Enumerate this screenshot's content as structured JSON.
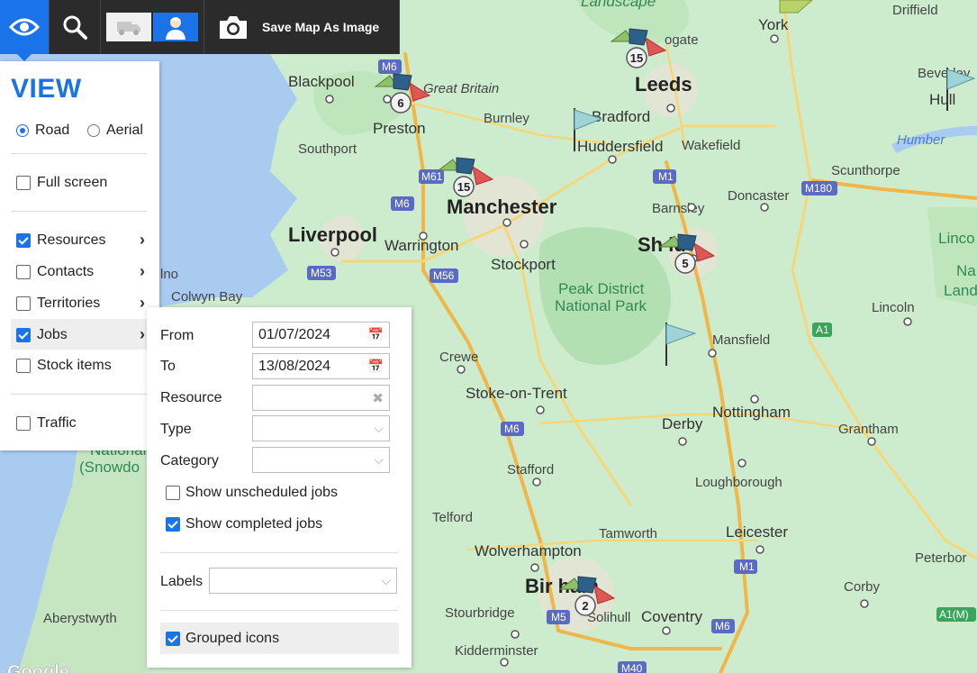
{
  "toolbar": {
    "save_label": "Save Map As Image",
    "accent": "#1a73e8"
  },
  "view_panel": {
    "title": "VIEW",
    "map_types": [
      {
        "label": "Road",
        "selected": true
      },
      {
        "label": "Aerial",
        "selected": false
      }
    ],
    "full_screen": {
      "label": "Full screen",
      "checked": false
    },
    "layers": [
      {
        "label": "Resources",
        "checked": true
      },
      {
        "label": "Contacts",
        "checked": false
      },
      {
        "label": "Territories",
        "checked": false
      },
      {
        "label": "Jobs",
        "checked": true
      },
      {
        "label": "Stock items",
        "checked": false
      }
    ],
    "traffic": {
      "label": "Traffic",
      "checked": false
    }
  },
  "jobs_panel": {
    "from_label": "From",
    "from_value": "01/07/2024",
    "to_label": "To",
    "to_value": "13/08/2024",
    "resource_label": "Resource",
    "type_label": "Type",
    "category_label": "Category",
    "unscheduled_label": "Show unscheduled jobs",
    "completed_label": "Show completed jobs",
    "labels_label": "Labels",
    "grouped_label": "Grouped icons"
  },
  "map": {
    "cities": {
      "leeds": "Leeds",
      "manchester": "Manchester",
      "liverpool": "Liverpool",
      "sheffield": "Sh   ld",
      "birmingham": "Bir        ham",
      "blackpool": "Blackpool",
      "preston": "Preston",
      "bradford": "Bradford",
      "huddersfield": "Huddersfield",
      "wakefield": "Wakefield",
      "york": "York",
      "hull": "Hull",
      "stockport": "Stockport",
      "warrington": "Warrington",
      "southport": "Southport",
      "burnley": "Burnley",
      "barnsley": "Barnsley",
      "doncaster": "Doncaster",
      "scunthorpe": "Scunthorpe",
      "lincoln": "Lincoln",
      "mansfield": "Mansfield",
      "nottingham": "Nottingham",
      "derby": "Derby",
      "grantham": "Grantham",
      "stoke": "Stoke-on-Trent",
      "crewe": "Crewe",
      "stafford": "Stafford",
      "telford": "Telford",
      "wolverhampton": "Wolverhampton",
      "tamworth": "Tamworth",
      "leicester": "Leicester",
      "loughborough": "Loughborough",
      "coventry": "Coventry",
      "solihull": "Solihull",
      "stourbridge": "Stourbridge",
      "kidderminster": "Kidderminster",
      "aberystwyth": "Aberystwyth",
      "corby": "Corby",
      "peterborough": "Peterbor",
      "colwyn_bay": "Colwyn Bay",
      "driffield": "Driffield",
      "beverley": "Beverley",
      "great_britain": "Great Britain",
      "harrogate": "ogate",
      "llandudno": "lno"
    },
    "water": {
      "humber": "Humber"
    },
    "parks": {
      "peak_line1": "Peak District",
      "peak_line2": "National Park",
      "snowdonia_line1": "National",
      "snowdonia_line2": "(Snowdo",
      "landscape": "Landscape",
      "lincs_line1": "Linco",
      "lincs_line2": "Na",
      "lincs_line3": "Land"
    },
    "roads": [
      "M6",
      "M61",
      "M6",
      "M53",
      "M56",
      "M1",
      "M180",
      "M6",
      "M1",
      "M5",
      "M6",
      "M40",
      "A1",
      "A1(M)"
    ],
    "clusters": [
      {
        "count": "15"
      },
      {
        "count": "6"
      },
      {
        "count": "15"
      },
      {
        "count": "5"
      },
      {
        "count": "2"
      }
    ],
    "colors": {
      "land": "#cdeccd",
      "water": "#a9cbf0",
      "park": "#8fd08f",
      "road": "#f5d77a",
      "motorway": "#f0b64a"
    }
  }
}
